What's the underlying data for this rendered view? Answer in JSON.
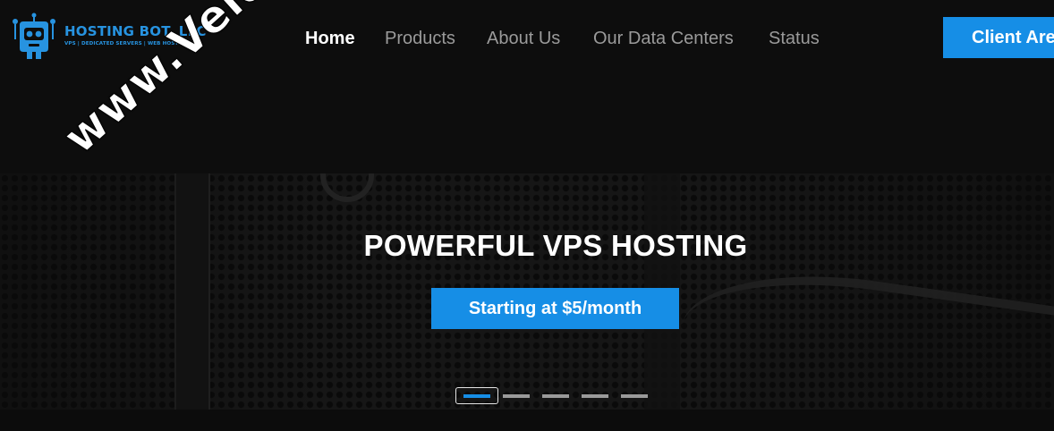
{
  "brand": {
    "name": "HOSTING BOT, LLC",
    "tagline": "VPS | DEDICATED SERVERS | WEB HOSTING",
    "accent_color": "#168ee6",
    "logo_icon": "robot-icon"
  },
  "nav": {
    "items": [
      {
        "label": "Home",
        "active": true
      },
      {
        "label": "Products",
        "active": false
      },
      {
        "label": "About Us",
        "active": false
      },
      {
        "label": "Our Data Centers",
        "active": false
      },
      {
        "label": "Status",
        "active": false
      }
    ],
    "client_button": "Client Area"
  },
  "hero": {
    "title": "POWERFUL VPS HOSTING",
    "cta": "Starting at $5/month",
    "slides_count": 5,
    "active_slide": 1
  },
  "watermark": {
    "text": "www.Veldc.com"
  }
}
